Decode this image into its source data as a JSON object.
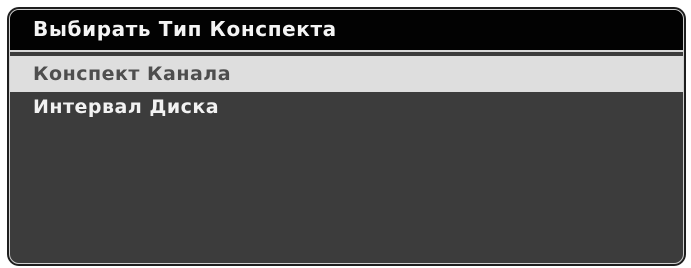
{
  "dialog": {
    "title": "Выбирать Тип Конспекта",
    "items": [
      {
        "label": "Конспект Канала",
        "selected": true
      },
      {
        "label": "Интервал Диска",
        "selected": false
      }
    ]
  },
  "colors": {
    "title_bar_bg": "#020202",
    "body_bg": "#3c3c3c",
    "selected_bg": "#dedede",
    "selected_text": "#4e4e4e",
    "text": "#f2f2f2"
  }
}
